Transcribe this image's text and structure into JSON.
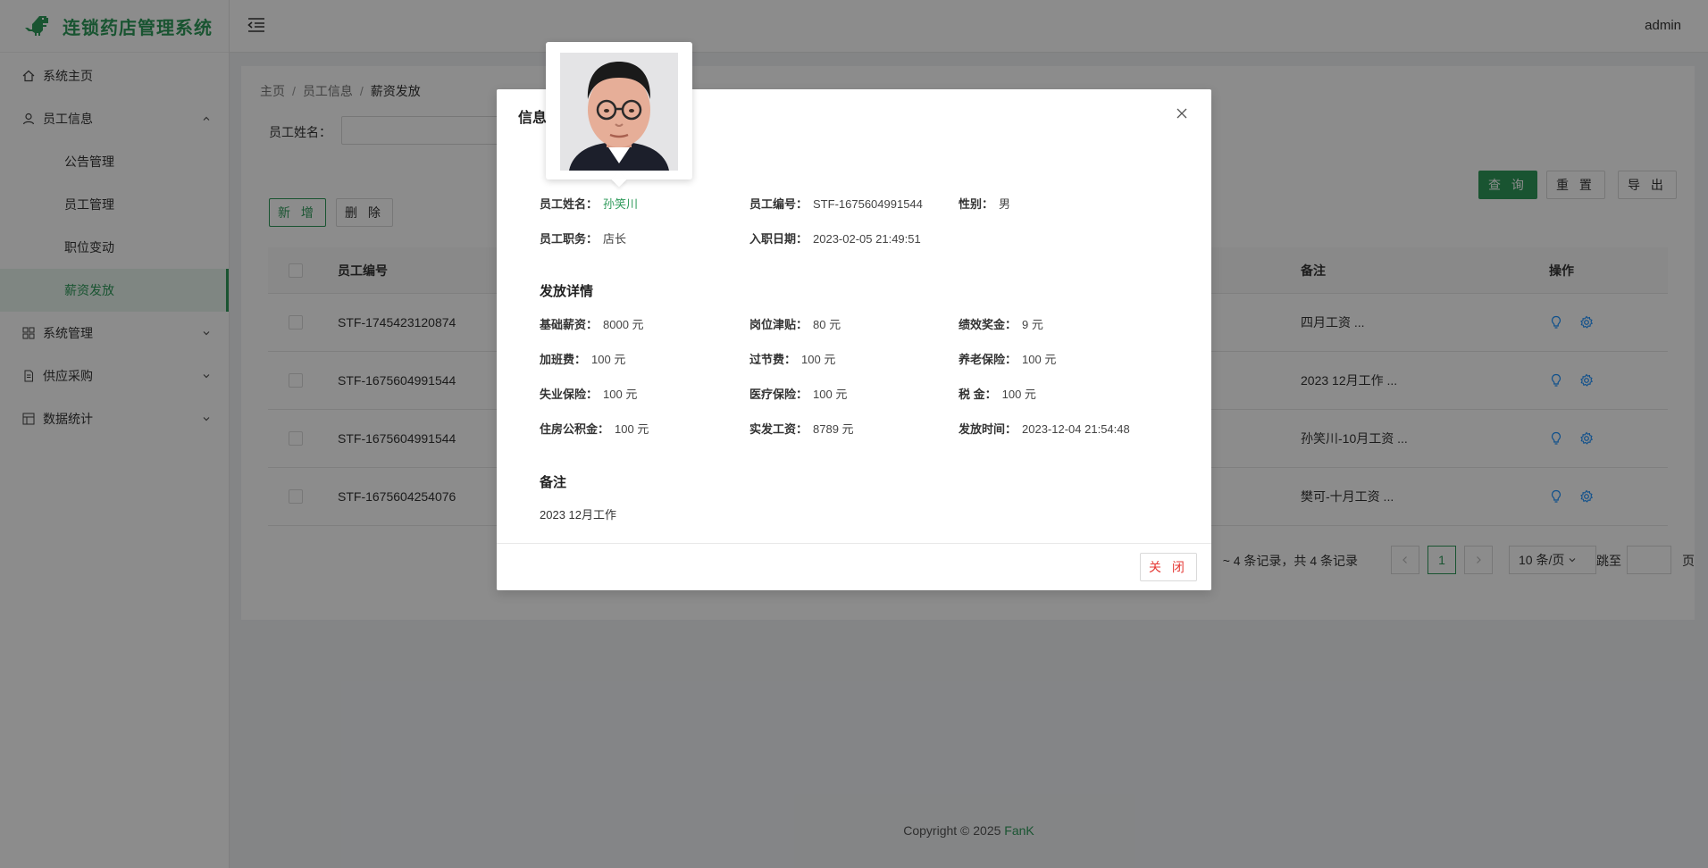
{
  "app": {
    "title": "连锁药店管理系统",
    "user": "admin"
  },
  "sidebar": {
    "items": [
      {
        "label": "系统主页"
      },
      {
        "label": "员工信息",
        "children": [
          {
            "label": "公告管理"
          },
          {
            "label": "员工管理"
          },
          {
            "label": "职位变动"
          },
          {
            "label": "薪资发放"
          }
        ]
      },
      {
        "label": "系统管理"
      },
      {
        "label": "供应采购"
      },
      {
        "label": "数据统计"
      }
    ]
  },
  "breadcrumb": {
    "home": "主页",
    "parent": "员工信息",
    "current": "薪资发放"
  },
  "search": {
    "label": "员工姓名：",
    "value": ""
  },
  "toolbar": {
    "query": "查 询",
    "reset": "重 置",
    "export": "导 出",
    "add": "新 增",
    "delete": "删 除"
  },
  "table": {
    "columns": {
      "id": "员工编号",
      "remark": "备注",
      "op": "操作"
    },
    "rows": [
      {
        "id": "STF-1745423120874",
        "remark": "四月工资 ..."
      },
      {
        "id": "STF-1675604991544",
        "remark": "2023 12月工作 ..."
      },
      {
        "id": "STF-1675604991544",
        "remark": "孙笑川-10月工资 ..."
      },
      {
        "id": "STF-1675604254076",
        "remark": "樊可-十月工资 ..."
      }
    ]
  },
  "pagination": {
    "info": "~ 4 条记录，共 4 条记录",
    "page": "1",
    "size": "10 条/页",
    "jump": "跳至",
    "page_unit": "页"
  },
  "footer": {
    "text": "Copyright © 2025",
    "author": "FanK"
  },
  "modal": {
    "title": "信息",
    "basic": {
      "name_k": "员工姓名：",
      "name_v": "孙笑川",
      "code_k": "员工编号：",
      "code_v": "STF-1675604991544",
      "gender_k": "性别：",
      "gender_v": "男",
      "post_k": "员工职务：",
      "post_v": "店长",
      "join_k": "入职日期：",
      "join_v": "2023-02-05 21:49:51"
    },
    "detail_title": "发放详情",
    "detail": [
      {
        "k": "基础薪资：",
        "v": "8000 元"
      },
      {
        "k": "岗位津贴：",
        "v": "80 元"
      },
      {
        "k": "绩效奖金：",
        "v": "9 元"
      },
      {
        "k": "加班费：",
        "v": "100 元"
      },
      {
        "k": "过节费：",
        "v": "100 元"
      },
      {
        "k": "养老保险：",
        "v": "100 元"
      },
      {
        "k": "失业保险：",
        "v": "100 元"
      },
      {
        "k": "医疗保险：",
        "v": "100 元"
      },
      {
        "k": "税 金：",
        "v": "100 元"
      },
      {
        "k": "住房公积金：",
        "v": "100 元"
      },
      {
        "k": "实发工资：",
        "v": "8789 元"
      },
      {
        "k": "发放时间：",
        "v": "2023-12-04 21:54:48"
      }
    ],
    "remark_title": "备注",
    "remark": "2023 12月工作",
    "close": "关 闭"
  },
  "colors": {
    "accent": "#2e9a5a",
    "danger": "#e53935",
    "icon_blue": "#1890ff"
  }
}
